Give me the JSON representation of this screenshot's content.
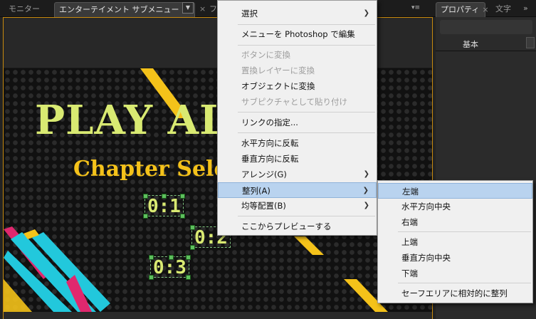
{
  "tabs": {
    "monitor": "モニター",
    "active": "エンターテイメント サブメニュー  HD",
    "partial": "フ",
    "properties": "プロパティ",
    "text": "文字"
  },
  "properties_panel": {
    "basic": "基本"
  },
  "canvas": {
    "play_all": "PLAY ALL",
    "chapter": "Chapter Selection",
    "chapters": [
      "0:1",
      "0:2",
      "0:3"
    ]
  },
  "menu": {
    "items": [
      {
        "label": "選択",
        "submenu": true
      },
      {
        "label": "メニューを Photoshop で編集"
      },
      {
        "label": "ボタンに変換",
        "disabled": true
      },
      {
        "label": "置換レイヤーに変換",
        "disabled": true
      },
      {
        "label": "オブジェクトに変換"
      },
      {
        "label": "サブピクチャとして貼り付け",
        "disabled": true
      },
      {
        "label": "リンクの指定..."
      },
      {
        "label": "水平方向に反転"
      },
      {
        "label": "垂直方向に反転"
      },
      {
        "label": "アレンジ(G)",
        "submenu": true
      },
      {
        "label": "整列(A)",
        "submenu": true,
        "highlighted": true
      },
      {
        "label": "均等配置(B)",
        "submenu": true
      },
      {
        "label": "ここからプレビューする"
      }
    ]
  },
  "submenu": {
    "items": [
      {
        "label": "左端",
        "highlighted": true
      },
      {
        "label": "水平方向中央"
      },
      {
        "label": "右端"
      },
      {
        "label": "上端"
      },
      {
        "label": "垂直方向中央"
      },
      {
        "label": "下端"
      },
      {
        "label": "セーフエリアに相対的に整列"
      }
    ]
  },
  "colors": {
    "accent_orange": "#c88a0e",
    "play_all": "#d9ea72",
    "chapter": "#f4c21a",
    "menu_highlight": "#b9d3ef",
    "stripe_cyan": "#22c8dc",
    "stripe_pink": "#e0286e",
    "stripe_yellow": "#f4c21a"
  }
}
